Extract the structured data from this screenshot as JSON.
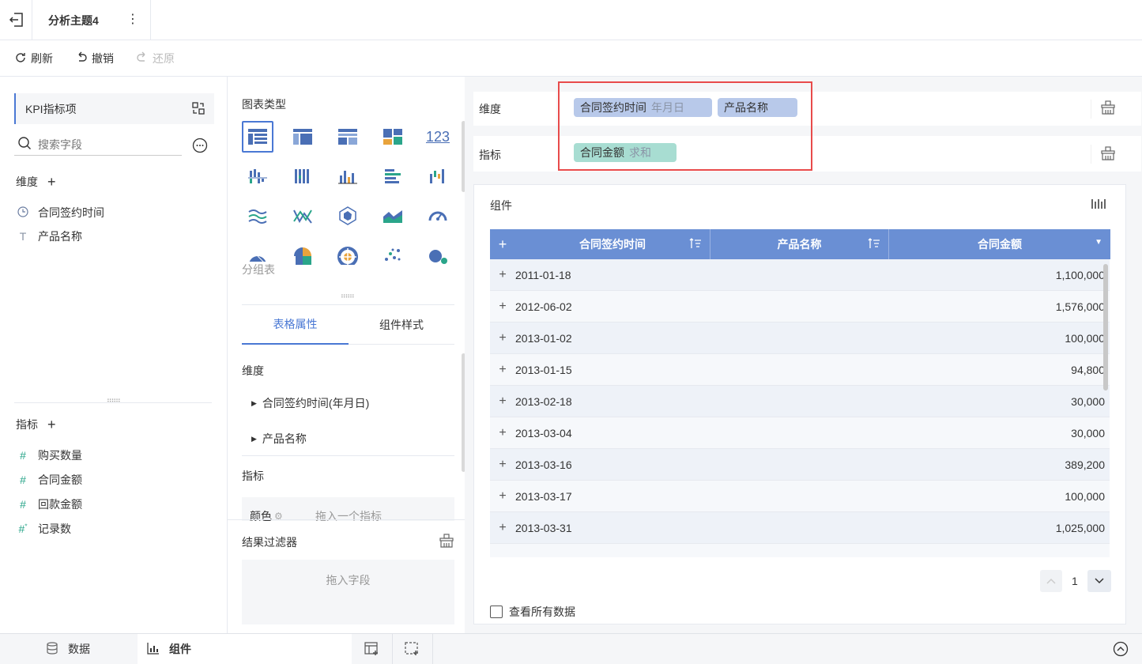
{
  "topbar": {
    "title": "分析主题4"
  },
  "toolbar": {
    "refresh": "刷新",
    "undo": "撤销",
    "redo": "还原"
  },
  "left": {
    "kpi_label": "KPI指标项",
    "search_placeholder": "搜索字段",
    "dimension_label": "维度",
    "dimensions": [
      "合同签约时间",
      "产品名称"
    ],
    "metric_label": "指标",
    "metrics": [
      "购买数量",
      "合同金额",
      "回款金额",
      "记录数"
    ]
  },
  "mid": {
    "chart_type_label": "图表类型",
    "chart_hint": "分组表",
    "tabs": [
      "表格属性",
      "组件样式"
    ],
    "dimension_label": "维度",
    "dim_items": [
      "合同签约时间(年月日)",
      "产品名称"
    ],
    "metric_label": "指标",
    "color_label": "颜色",
    "drag_metric": "拖入一个指标",
    "filter_label": "结果过滤器",
    "drag_field": "拖入字段"
  },
  "right": {
    "dimension_label": "维度",
    "dim_pills": [
      {
        "name": "合同签约时间",
        "sub": "年月日"
      },
      {
        "name": "产品名称",
        "sub": ""
      }
    ],
    "metric_label": "指标",
    "metric_pills": [
      {
        "name": "合同金额",
        "sub": "求和"
      }
    ],
    "widget_title": "组件",
    "table": {
      "headers": [
        "合同签约时间",
        "产品名称",
        "合同金额"
      ],
      "rows": [
        [
          "2011-01-18",
          "1,100,000"
        ],
        [
          "2012-06-02",
          "1,576,000"
        ],
        [
          "2013-01-02",
          "100,000"
        ],
        [
          "2013-01-15",
          "94,800"
        ],
        [
          "2013-02-18",
          "30,000"
        ],
        [
          "2013-03-04",
          "30,000"
        ],
        [
          "2013-03-16",
          "389,200"
        ],
        [
          "2013-03-17",
          "100,000"
        ],
        [
          "2013-03-31",
          "1,025,000"
        ]
      ]
    },
    "page": "1",
    "view_all": "查看所有数据"
  },
  "bottom": {
    "tab_data": "数据",
    "tab_widget": "组件"
  },
  "colors": {
    "accent": "#4a78d4",
    "header": "#6a8fd4",
    "dim_pill": "#b8c9ea",
    "metric_pill": "#a8ddd2",
    "highlight": "#e84b4b"
  }
}
